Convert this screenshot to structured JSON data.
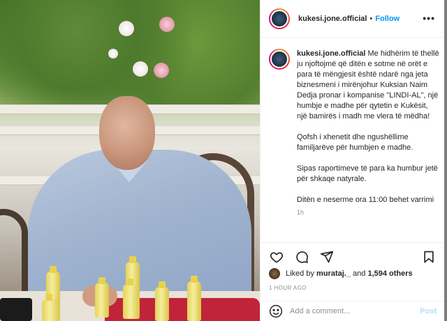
{
  "header": {
    "username": "kukesi.jone.official",
    "separator": "•",
    "follow_label": "Follow",
    "more_label": "•••"
  },
  "caption": {
    "username": "kukesi.jone.official",
    "paragraphs": [
      "Me hidhërim të thellë ju njoftojmë që ditën e sotme në orët e para të mëngjesit është ndarë nga jeta biznesmeni i mirënjohur Kuksian Naim Dedja pronar i kompanise \"LINDI-AL\", një humbje e madhe për qytetin e Kukësit, një bamirës i madh me vlera të mëdha!",
      "Qofsh i xhenetit dhe ngushëllime familjarëve për humbjen e madhe.",
      "Sipas raportimeve të para ka humbur jetë për shkaqe natyrale.",
      "Ditën e neserme ora 11:00 behet varrimi"
    ],
    "time": "1h"
  },
  "actions": {
    "like_icon": "heart-icon",
    "comment_icon": "comment-icon",
    "share_icon": "share-icon",
    "save_icon": "bookmark-icon"
  },
  "likes": {
    "prefix": "Liked by",
    "liker": "murataj._",
    "middle": "and",
    "count_text": "1,594 others"
  },
  "time_ago": "1 HOUR AGO",
  "comment_box": {
    "placeholder": "Add a comment...",
    "post_label": "Post",
    "emoji_icon": "emoji-icon"
  },
  "colors": {
    "follow": "#0095f6",
    "post_disabled": "#b2dffc",
    "text": "#262626",
    "muted": "#8e8e8e"
  }
}
